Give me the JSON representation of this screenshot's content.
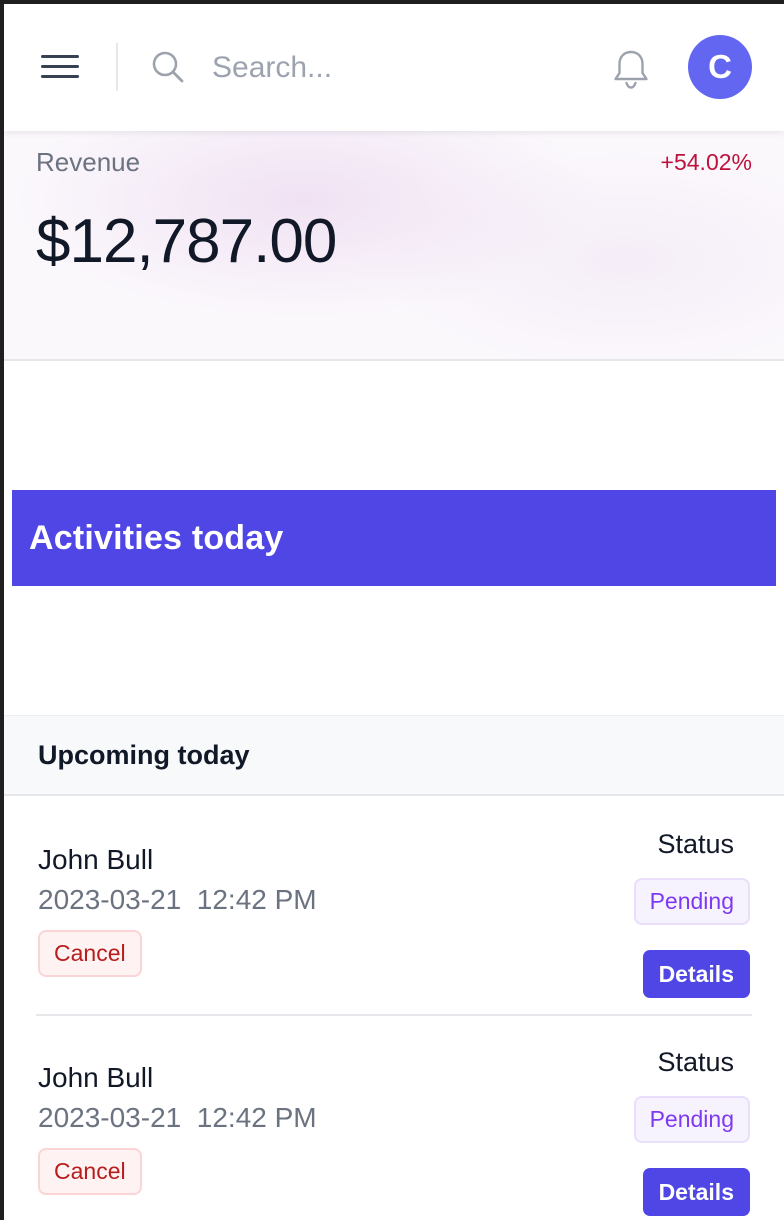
{
  "header": {
    "search_placeholder": "Search...",
    "avatar_initial": "C"
  },
  "revenue": {
    "label": "Revenue",
    "change": "+54.02%",
    "value": "$12,787.00"
  },
  "activities": {
    "title": "Activities today"
  },
  "upcoming": {
    "title": "Upcoming today",
    "items": [
      {
        "name": "John Bull",
        "date": "2023-03-21  12:42 PM",
        "cancel_label": "Cancel",
        "status_label": "Status",
        "status": "Pending",
        "details_label": "Details"
      },
      {
        "name": "John Bull",
        "date": "2023-03-21  12:42 PM",
        "cancel_label": "Cancel",
        "status_label": "Status",
        "status": "Pending",
        "details_label": "Details"
      }
    ]
  },
  "colors": {
    "accent": "#4f46e5",
    "avatar": "#6366f1",
    "change_negative_red": "#be123c",
    "pending": "#7e3af2",
    "cancel": "#b91c1c"
  },
  "icons": {
    "menu": "hamburger-icon",
    "search": "search-icon",
    "notifications": "bell-icon"
  }
}
